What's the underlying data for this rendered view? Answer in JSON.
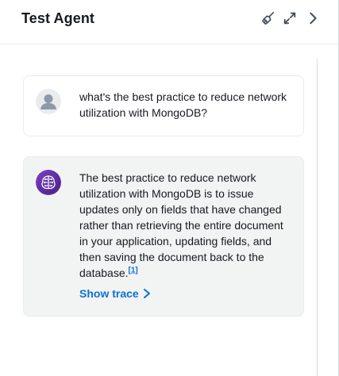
{
  "header": {
    "title": "Test Agent",
    "icons": [
      "broom-icon",
      "expand-icon",
      "chevron-right-icon"
    ]
  },
  "conversation": {
    "user_message": {
      "avatar": "user-avatar-icon",
      "text": "what's the best practice to reduce network utilization with MongoDB?"
    },
    "agent_message": {
      "avatar": "agent-brain-icon",
      "text": "The best practice to reduce network utilization with MongoDB is to issue updates only on fields that have changed rather than retrieving the entire document in your application, updating fields, and then saving the document back to the database.",
      "citation": "[1]",
      "show_trace_label": "Show trace"
    }
  },
  "colors": {
    "link": "#0972d3",
    "agent_avatar_bg": "#5c2d91",
    "agent_bubble_bg": "#f2f3f3",
    "text": "#16191f"
  }
}
